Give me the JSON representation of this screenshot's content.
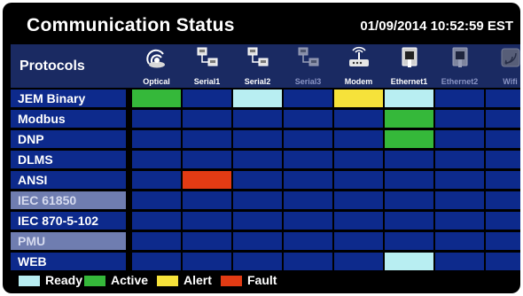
{
  "header": {
    "title": "Communication Status",
    "datetime": "01/09/2014 10:52:59 EST"
  },
  "protocols_label": "Protocols",
  "columns": [
    {
      "label": "Optical",
      "icon": "optical-port-icon",
      "dim": false
    },
    {
      "label": "Serial1",
      "icon": "serial-port-icon",
      "dim": false
    },
    {
      "label": "Serial2",
      "icon": "serial-port-icon",
      "dim": false
    },
    {
      "label": "Serial3",
      "icon": "serial-port-icon",
      "dim": true
    },
    {
      "label": "Modem",
      "icon": "modem-icon",
      "dim": false
    },
    {
      "label": "Ethernet1",
      "icon": "ethernet-icon",
      "dim": false
    },
    {
      "label": "Ethernet2",
      "icon": "ethernet-icon",
      "dim": true
    },
    {
      "label": "Wifi",
      "icon": "wifi-icon",
      "dim": true
    }
  ],
  "rows": [
    {
      "name": "JEM Binary",
      "dim": false,
      "status": [
        "active",
        "",
        "ready",
        "",
        "alert",
        "ready",
        "",
        ""
      ]
    },
    {
      "name": "Modbus",
      "dim": false,
      "status": [
        "",
        "",
        "",
        "",
        "",
        "active",
        "",
        ""
      ]
    },
    {
      "name": "DNP",
      "dim": false,
      "status": [
        "",
        "",
        "",
        "",
        "",
        "active",
        "",
        ""
      ]
    },
    {
      "name": "DLMS",
      "dim": false,
      "status": [
        "",
        "",
        "",
        "",
        "",
        "",
        "",
        ""
      ]
    },
    {
      "name": "ANSI",
      "dim": false,
      "status": [
        "",
        "fault",
        "",
        "",
        "",
        "",
        "",
        ""
      ]
    },
    {
      "name": "IEC 61850",
      "dim": true,
      "status": [
        "",
        "",
        "",
        "",
        "",
        "",
        "",
        ""
      ]
    },
    {
      "name": "IEC 870-5-102",
      "dim": false,
      "status": [
        "",
        "",
        "",
        "",
        "",
        "",
        "",
        ""
      ]
    },
    {
      "name": "PMU",
      "dim": true,
      "status": [
        "",
        "",
        "",
        "",
        "",
        "",
        "",
        ""
      ]
    },
    {
      "name": "WEB",
      "dim": false,
      "status": [
        "",
        "",
        "",
        "",
        "",
        "ready",
        "",
        ""
      ]
    }
  ],
  "legend": [
    {
      "label": "Ready",
      "status": "ready"
    },
    {
      "label": "Active",
      "status": "active"
    },
    {
      "label": "Alert",
      "status": "alert"
    },
    {
      "label": "Fault",
      "status": "fault"
    }
  ],
  "colors": {
    "ready": "#b8eef2",
    "active": "#35b83a",
    "alert": "#f6e23a",
    "fault": "#e23b14",
    "empty": "#0d2a8c"
  }
}
